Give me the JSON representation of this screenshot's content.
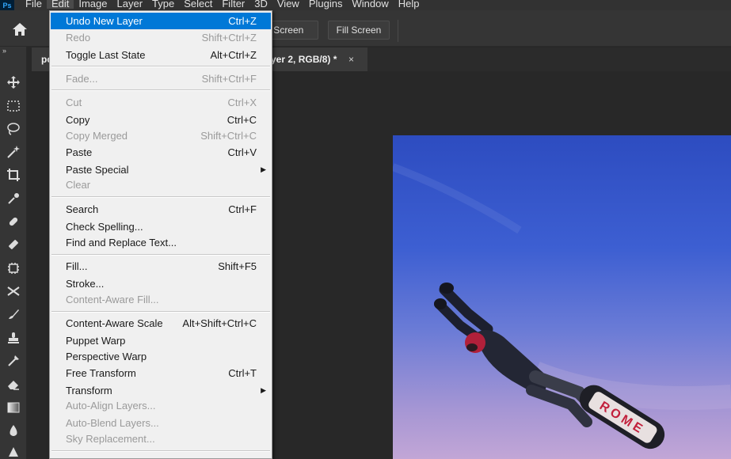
{
  "menubar": {
    "logo": "Ps",
    "items": [
      "File",
      "Edit",
      "Image",
      "Layer",
      "Type",
      "Select",
      "Filter",
      "3D",
      "View",
      "Plugins",
      "Window",
      "Help"
    ]
  },
  "options_bar": {
    "fit_screen_label": "t Screen",
    "fill_screen_label": "Fill Screen"
  },
  "document_tab": {
    "title_left": "pc",
    "title_right": "yer 2, RGB/8) *",
    "close_glyph": "×"
  },
  "toolbar": {
    "collapse_glyph": "»",
    "tools": [
      "move-tool",
      "marquee-tool",
      "lasso-tool",
      "magic-wand-tool",
      "crop-tool",
      "eyedropper-tool",
      "healing-brush-tool",
      "brush-tool",
      "clone-stamp-tool",
      "history-brush-tool",
      "eraser-tool",
      "gradient-tool",
      "blur-tool",
      "dodge-tool"
    ]
  },
  "edit_menu": {
    "items": [
      {
        "label": "Undo New Layer",
        "shortcut": "Ctrl+Z",
        "state": "highlighted"
      },
      {
        "label": "Redo",
        "shortcut": "Shift+Ctrl+Z",
        "state": "disabled"
      },
      {
        "label": "Toggle Last State",
        "shortcut": "Alt+Ctrl+Z",
        "state": "enabled"
      },
      {
        "label": "Fade...",
        "shortcut": "Shift+Ctrl+F",
        "state": "disabled"
      },
      {
        "label": "Cut",
        "shortcut": "Ctrl+X",
        "state": "disabled"
      },
      {
        "label": "Copy",
        "shortcut": "Ctrl+C",
        "state": "enabled"
      },
      {
        "label": "Copy Merged",
        "shortcut": "Shift+Ctrl+C",
        "state": "disabled"
      },
      {
        "label": "Paste",
        "shortcut": "Ctrl+V",
        "state": "enabled"
      },
      {
        "label": "Paste Special",
        "shortcut": "",
        "state": "enabled",
        "submenu": true
      },
      {
        "label": "Clear",
        "shortcut": "",
        "state": "disabled"
      },
      {
        "label": "Search",
        "shortcut": "Ctrl+F",
        "state": "enabled"
      },
      {
        "label": "Check Spelling...",
        "shortcut": "",
        "state": "enabled"
      },
      {
        "label": "Find and Replace Text...",
        "shortcut": "",
        "state": "enabled"
      },
      {
        "label": "Fill...",
        "shortcut": "Shift+F5",
        "state": "enabled"
      },
      {
        "label": "Stroke...",
        "shortcut": "",
        "state": "enabled"
      },
      {
        "label": "Content-Aware Fill...",
        "shortcut": "",
        "state": "disabled"
      },
      {
        "label": "Content-Aware Scale",
        "shortcut": "Alt+Shift+Ctrl+C",
        "state": "enabled"
      },
      {
        "label": "Puppet Warp",
        "shortcut": "",
        "state": "enabled"
      },
      {
        "label": "Perspective Warp",
        "shortcut": "",
        "state": "enabled"
      },
      {
        "label": "Free Transform",
        "shortcut": "Ctrl+T",
        "state": "enabled"
      },
      {
        "label": "Transform",
        "shortcut": "",
        "state": "enabled",
        "submenu": true
      },
      {
        "label": "Auto-Align Layers...",
        "shortcut": "",
        "state": "disabled"
      },
      {
        "label": "Auto-Blend Layers...",
        "shortcut": "",
        "state": "disabled"
      },
      {
        "label": "Sky Replacement...",
        "shortcut": "",
        "state": "disabled"
      }
    ]
  },
  "board_text": "ROME",
  "colors": {
    "menu_highlight": "#0078d7",
    "menu_bg": "#f0f0f0",
    "app_bg": "#282828",
    "panel_bg": "#353535",
    "sky_top": "#2f4fbf",
    "sky_bottom": "#b39cd0"
  }
}
